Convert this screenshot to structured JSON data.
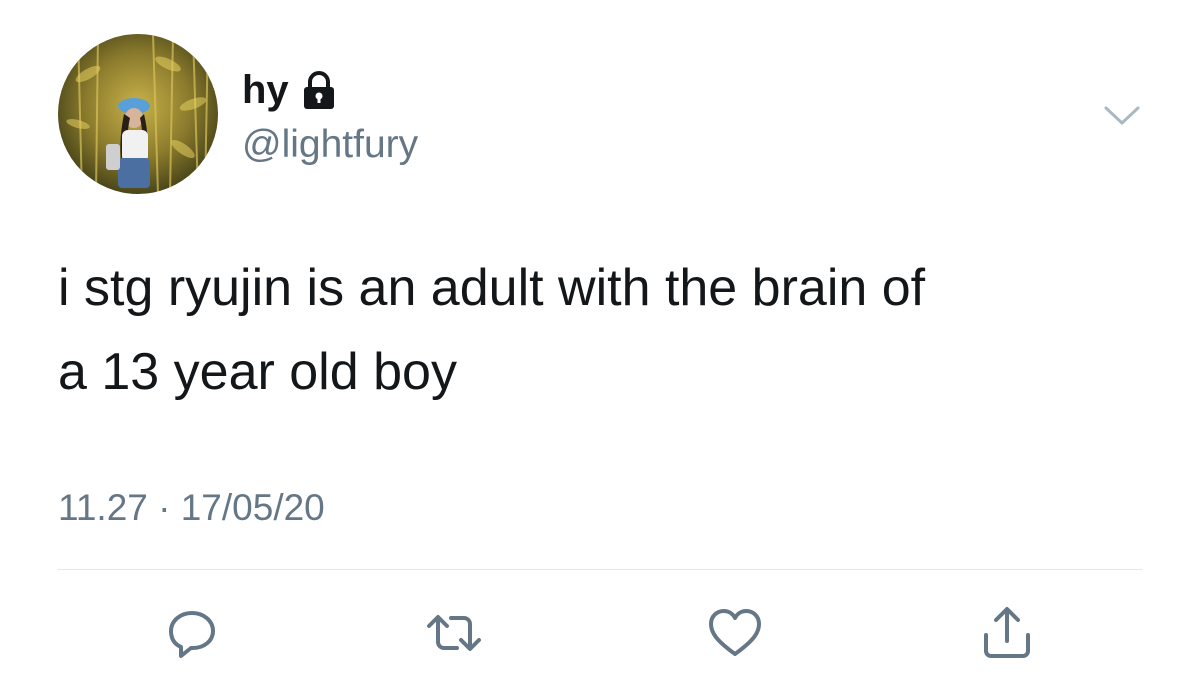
{
  "user": {
    "display_name": "hy",
    "handle": "@lightfury",
    "protected": true
  },
  "tweet": {
    "text": "i stg ryujin is an adult with the brain of\na 13 year old boy",
    "timestamp": "11.27 · 17/05/20"
  },
  "icons": {
    "lock": "lock-icon",
    "menu": "chevron-down-icon",
    "reply": "reply-icon",
    "retweet": "retweet-icon",
    "like": "heart-icon",
    "share": "share-icon"
  },
  "colors": {
    "text_primary": "#14171a",
    "text_secondary": "#657786",
    "divider": "#e1e8ed",
    "icon": "#657786"
  }
}
